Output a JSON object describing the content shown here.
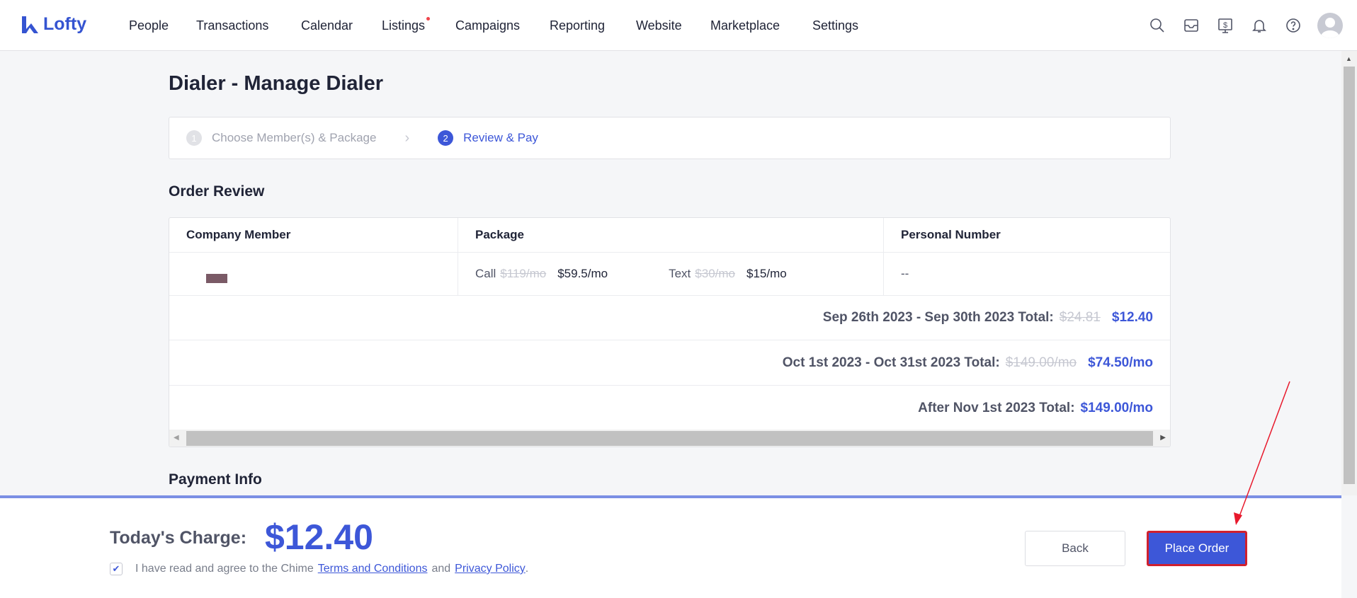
{
  "header": {
    "logo": "Lofty",
    "nav": [
      "People",
      "Transactions",
      "Calendar",
      "Listings",
      "Campaigns",
      "Reporting",
      "Website",
      "Marketplace",
      "Settings"
    ]
  },
  "page_title": "Dialer - Manage Dialer",
  "steps": [
    {
      "num": "1",
      "label": "Choose Member(s) & Package"
    },
    {
      "num": "2",
      "label": "Review & Pay"
    }
  ],
  "order_review": {
    "title": "Order Review",
    "columns": [
      "Company Member",
      "Package",
      "Personal Number"
    ],
    "row": {
      "call_label": "Call",
      "call_old": "$119/mo",
      "call_new": "$59.5/mo",
      "text_label": "Text",
      "text_old": "$30/mo",
      "text_new": "$15/mo",
      "personal_number": "--"
    },
    "totals": [
      {
        "label": "Sep 26th 2023 - Sep 30th 2023 Total:",
        "old": "$24.81",
        "new": "$12.40"
      },
      {
        "label": "Oct 1st 2023 - Oct 31st 2023 Total:",
        "old": "$149.00/mo",
        "new": "$74.50/mo"
      },
      {
        "label": "After Nov 1st 2023 Total:",
        "old": "",
        "new": "$149.00/mo"
      }
    ]
  },
  "payment_info": "Payment Info",
  "footer": {
    "charge_label": "Today's Charge:",
    "charge": "$12.40",
    "agree_prefix": "I have read and agree to the Chime",
    "terms": "Terms and Conditions",
    "and": "and",
    "privacy": "Privacy Policy",
    "period": ".",
    "back": "Back",
    "place_order": "Place Order"
  }
}
